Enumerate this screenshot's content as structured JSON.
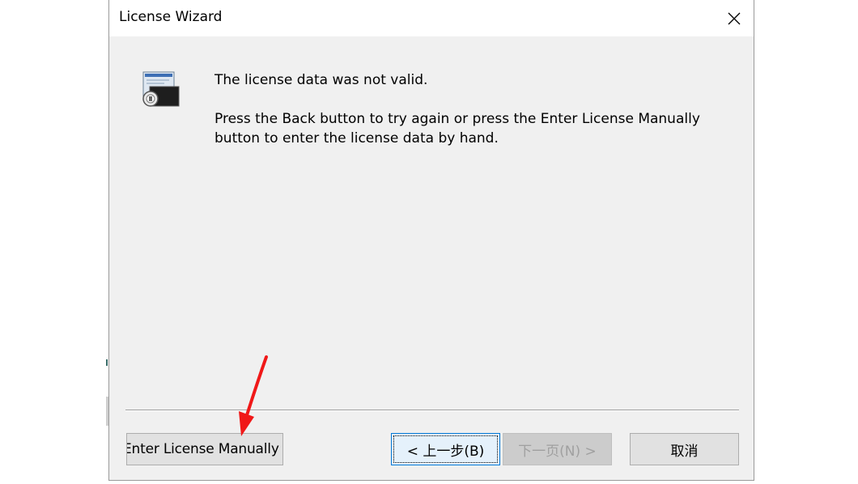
{
  "window": {
    "title": "License Wizard",
    "close_glyph": "✕"
  },
  "content": {
    "icon": "license-certificate-icon",
    "message_title": "The license data was not valid.",
    "message_body": "Press the Back button to try again or press the Enter License Manually button to enter the license data by hand."
  },
  "buttons": {
    "enter_manually": "Enter License Manually",
    "back": "< 上一步(B)",
    "next": "下一页(N) >",
    "cancel": "取消"
  },
  "annotation": {
    "arrow_color": "#f01818"
  },
  "colors": {
    "dialog_bg": "#f0f0f0",
    "focus_border": "#0078d7"
  }
}
